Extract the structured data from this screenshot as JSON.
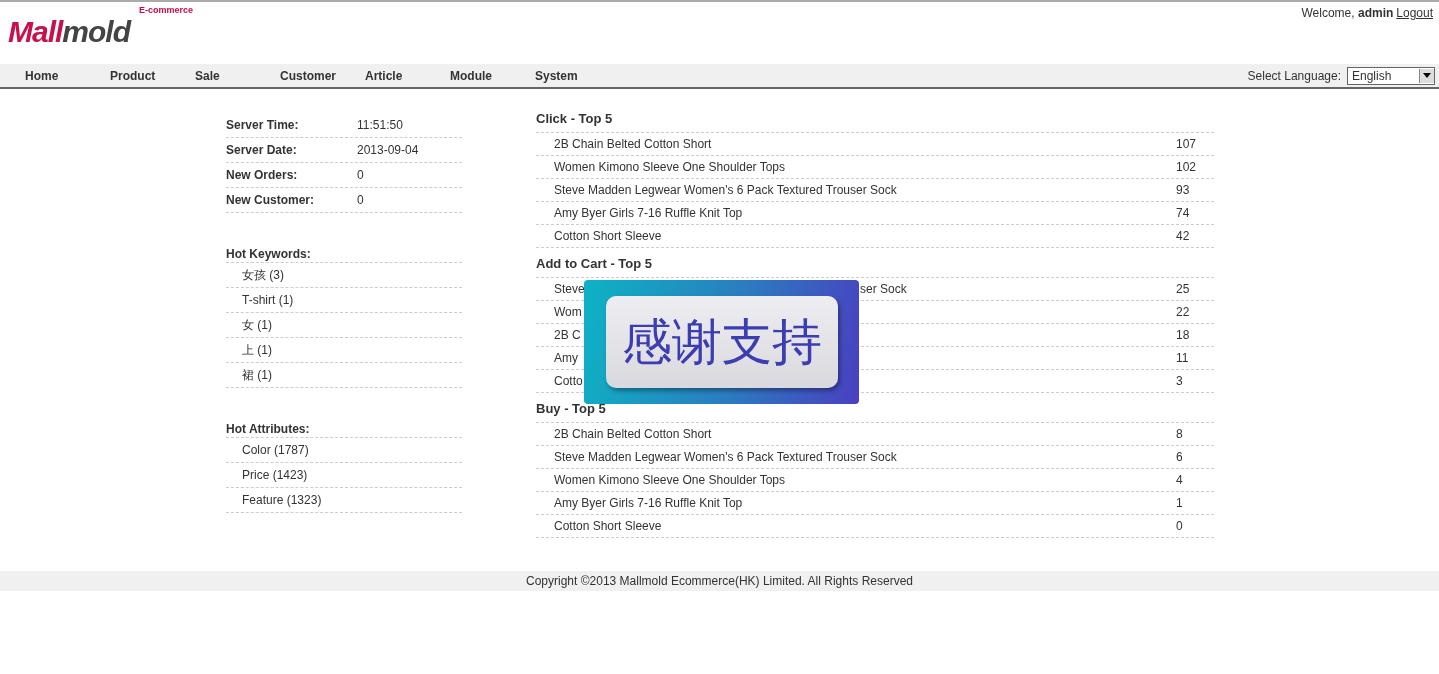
{
  "header": {
    "tagline": "E-commerce",
    "logo": {
      "first": "Mall",
      "second": "mold"
    },
    "welcome": "Welcome, **admin**",
    "logout": "Logout"
  },
  "nav": {
    "items": [
      "Home",
      "Product",
      "Sale",
      "Customer",
      "Article",
      "Module",
      "System"
    ],
    "language_label": "Select Language:",
    "language": "English"
  },
  "stats": [
    {
      "label": "Server Time:",
      "value": "11:51:50"
    },
    {
      "label": "Server Date:",
      "value": "2013-09-04"
    },
    {
      "label": "New Orders:",
      "value": "0"
    },
    {
      "label": "New Customer:",
      "value": "0"
    }
  ],
  "hot_keywords": {
    "title": "Hot Keywords:",
    "items": [
      "女孩 (3)",
      "T-shirt (1)",
      "女 (1)",
      "上 (1)",
      "裙 (1)"
    ]
  },
  "hot_attributes": {
    "title": "Hot Attributes:",
    "items": [
      "Color (1787)",
      "Price (1423)",
      "Feature (1323)"
    ]
  },
  "sections": [
    {
      "title": "Click - Top 5",
      "rows": [
        {
          "name": "2B Chain Belted Cotton Short",
          "count": "107"
        },
        {
          "name": "Women Kimono Sleeve One Shoulder Tops",
          "count": "102"
        },
        {
          "name": "Steve Madden Legwear Women's 6 Pack Textured Trouser Sock",
          "count": "93"
        },
        {
          "name": "Amy Byer Girls 7-16 Ruffle Knit Top",
          "count": "74"
        },
        {
          "name": "Cotton Short Sleeve",
          "count": "42"
        }
      ]
    },
    {
      "title": "Add to Cart - Top 5",
      "rows": [
        {
          "name": "Steve",
          "tail": "ser Sock",
          "count": "25"
        },
        {
          "name": "Wom",
          "count": "22"
        },
        {
          "name": "2B C",
          "count": "18"
        },
        {
          "name": "Amy",
          "count": "11"
        },
        {
          "name": "Cotto",
          "count": "3"
        }
      ]
    },
    {
      "title": "Buy - Top 5",
      "rows": [
        {
          "name": "2B Chain Belted Cotton Short",
          "count": "8"
        },
        {
          "name": "Steve Madden Legwear Women's 6 Pack Textured Trouser Sock",
          "count": "6"
        },
        {
          "name": "Women Kimono Sleeve One Shoulder Tops",
          "count": "4"
        },
        {
          "name": "Amy Byer Girls 7-16 Ruffle Knit Top",
          "count": "1"
        },
        {
          "name": "Cotton Short Sleeve",
          "count": "0"
        }
      ]
    }
  ],
  "overlay": {
    "text": "感谢支持"
  },
  "footer": "Copyright ©2013 Mallmold Ecommerce(HK) Limited. All Rights Reserved"
}
